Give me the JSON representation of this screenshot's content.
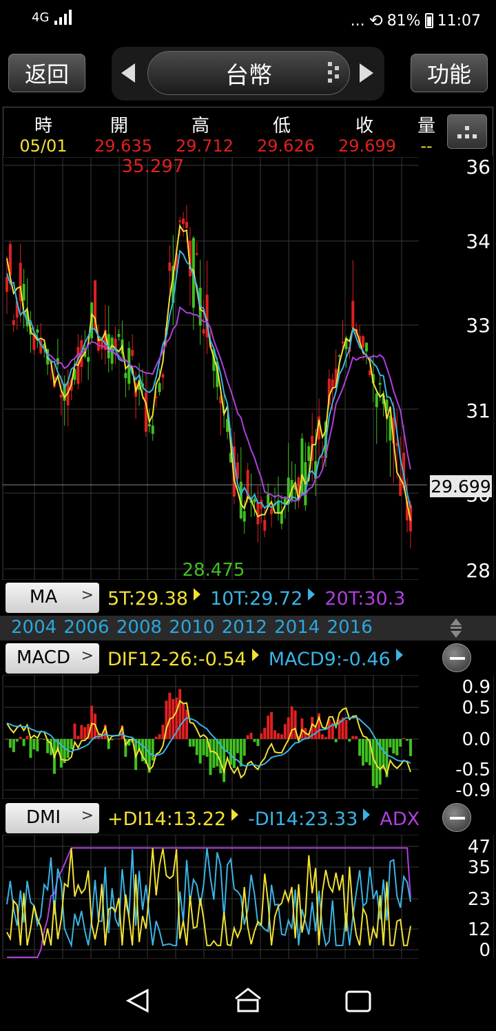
{
  "status_bar": {
    "network": "4G",
    "dots": "...",
    "battery": "81%",
    "time": "11:07"
  },
  "top_bar": {
    "back_label": "返回",
    "title": "台幣",
    "function_label": "功能"
  },
  "quote": {
    "headers": [
      "時",
      "開",
      "高",
      "低",
      "收",
      "量"
    ],
    "values": [
      "05/01",
      "29.635",
      "29.712",
      "29.626",
      "29.699",
      "--"
    ]
  },
  "main_chart": {
    "y_ticks": [
      "36",
      "34",
      "33",
      "31",
      "30",
      "28"
    ],
    "high_label": "35.297",
    "low_label": "28.475",
    "last_price_label": "29.699"
  },
  "ma": {
    "button_label": "MA",
    "values": [
      {
        "text": "5T:29.38",
        "color": "#f2e234"
      },
      {
        "text": "10T:29.72",
        "color": "#3ab4e6"
      },
      {
        "text": "20T:30.3",
        "color": "#b040e0"
      }
    ]
  },
  "years": "2004 2006 2008 2010 2012 2014 2016",
  "macd": {
    "button_label": "MACD",
    "values": [
      {
        "text": "DIF12-26:-0.54",
        "color": "#f2e234"
      },
      {
        "text": "MACD9:-0.46",
        "color": "#3ab4e6"
      }
    ],
    "y_ticks": [
      "0.9",
      "0.5",
      "0.0",
      "-0.5",
      "-0.9"
    ]
  },
  "dmi": {
    "button_label": "DMI",
    "values": [
      {
        "text": "+DI14:13.22",
        "color": "#f2e234"
      },
      {
        "text": "-DI14:23.33",
        "color": "#3ab4e6"
      },
      {
        "text": "ADX",
        "color": "#b040e0"
      }
    ],
    "y_ticks": [
      "47",
      "35",
      "23",
      "12",
      "0"
    ]
  },
  "colors": {
    "up": "#e02020",
    "down": "#40c020",
    "ma5": "#f2e234",
    "ma10": "#3ab4e6",
    "ma20": "#b040e0"
  },
  "chart_data": {
    "type": "line",
    "title": "台幣",
    "x": [
      "2004",
      "2006",
      "2008",
      "2010",
      "2012",
      "2014",
      "2016"
    ],
    "series": [
      {
        "name": "5T",
        "values": [
          33.8,
          32.9,
          31.2,
          33.0,
          32.3,
          30.9,
          34.5,
          32.7,
          29.8,
          29.5,
          29.9,
          30.8,
          33.0,
          31.4,
          29.4
        ]
      },
      {
        "name": "10T",
        "values": [
          33.6,
          32.8,
          31.6,
          32.9,
          32.2,
          31.4,
          34.0,
          32.9,
          30.1,
          29.7,
          29.8,
          30.5,
          32.8,
          31.8,
          29.7
        ]
      },
      {
        "name": "20T",
        "values": [
          33.3,
          32.6,
          32.0,
          32.6,
          32.2,
          31.8,
          33.2,
          33.0,
          31.0,
          30.0,
          29.8,
          30.3,
          32.2,
          32.3,
          30.3
        ]
      }
    ],
    "ylim": [
      28,
      36
    ],
    "high": 35.297,
    "low": 28.475,
    "last": 29.699
  }
}
